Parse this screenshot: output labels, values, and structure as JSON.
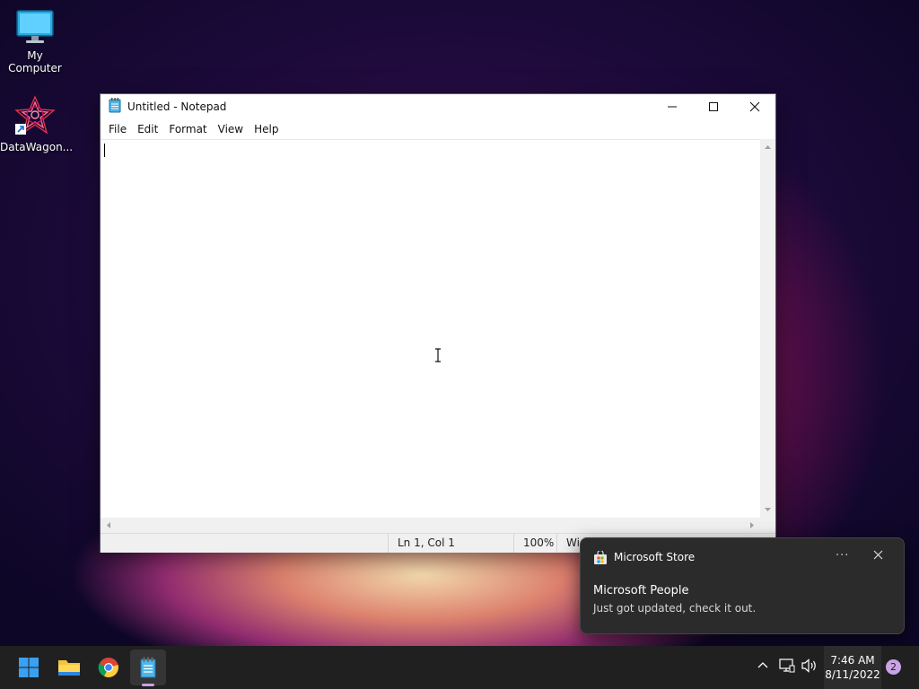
{
  "desktop": {
    "icons": [
      {
        "label": "My Computer",
        "icon": "monitor-icon"
      },
      {
        "label": "DataWagon...",
        "icon": "datawagon-icon"
      }
    ]
  },
  "notepad": {
    "title": "Untitled - Notepad",
    "menu": [
      "File",
      "Edit",
      "Format",
      "View",
      "Help"
    ],
    "content": "",
    "status": {
      "position": "Ln 1, Col 1",
      "zoom": "100%",
      "line_ending_partial": "Wi"
    }
  },
  "notification": {
    "app": "Microsoft Store",
    "title": "Microsoft People",
    "body": "Just got updated, check it out.",
    "more_label": "···"
  },
  "taskbar": {
    "apps": [
      "start-icon",
      "file-explorer-icon",
      "chrome-icon",
      "notepad-icon"
    ],
    "time": "7:46 AM",
    "date": "8/11/2022",
    "notification_count": "2"
  },
  "colors": {
    "accent": "#c9a3e6",
    "taskbar": "#202020",
    "toast": "#2b2b2b"
  }
}
